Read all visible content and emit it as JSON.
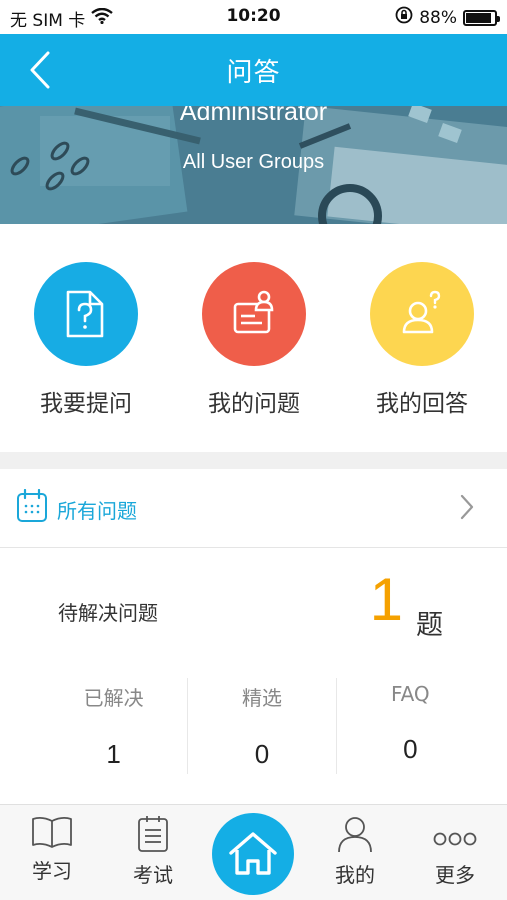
{
  "status_bar": {
    "carrier": "无 SIM 卡",
    "time": "10:20",
    "battery_percent": "88%",
    "battery_level": 0.88
  },
  "nav": {
    "title": "问答",
    "back_icon": "chevron-left-icon"
  },
  "banner": {
    "user_name": "Administrator",
    "user_group": "All User Groups"
  },
  "actions": [
    {
      "label": "我要提问",
      "icon": "question-document-icon",
      "color": "#17ace4"
    },
    {
      "label": "我的问题",
      "icon": "user-card-icon",
      "color": "#ef5e4a"
    },
    {
      "label": "我的回答",
      "icon": "user-question-icon",
      "color": "#fdd650"
    }
  ],
  "all_questions": {
    "label": "所有问题",
    "icon": "calendar-icon"
  },
  "pending": {
    "label": "待解决问题",
    "count": "1",
    "unit": "题"
  },
  "stats": [
    {
      "label": "已解决",
      "value": "1"
    },
    {
      "label": "精选",
      "value": "0"
    },
    {
      "label": "FAQ",
      "value": "0"
    }
  ],
  "tabs": [
    {
      "label": "学习",
      "icon": "book-icon"
    },
    {
      "label": "考试",
      "icon": "notepad-icon"
    },
    {
      "label": "",
      "icon": "home-icon"
    },
    {
      "label": "我的",
      "icon": "person-icon"
    },
    {
      "label": "更多",
      "icon": "more-dots-icon"
    }
  ],
  "colors": {
    "primary": "#14aee5",
    "accent_orange": "#f5a100"
  }
}
